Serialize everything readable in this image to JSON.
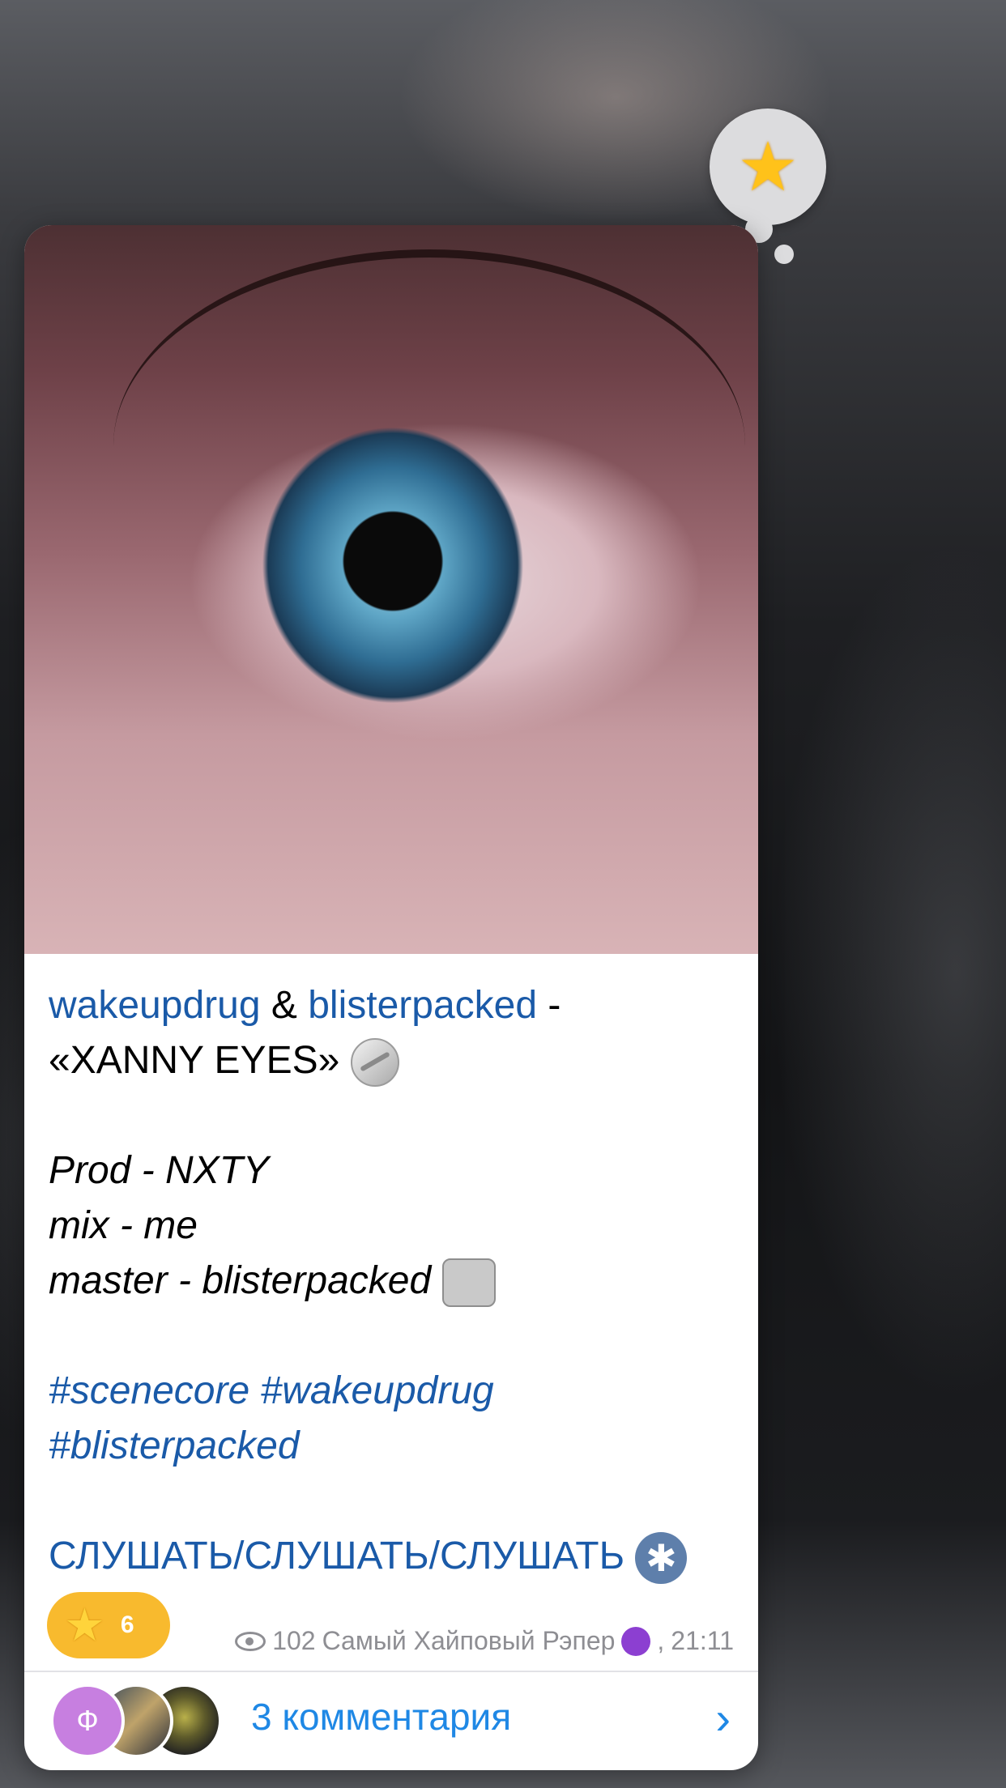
{
  "post": {
    "caption": {
      "artist1": "wakeupdrug",
      "amp": " & ",
      "artist2": "blisterpacked",
      "dash": " -",
      "title": "«XANNY EYES»",
      "prod": "Prod - NXTY",
      "mix": "mix - me",
      "master": "master - blisterpacked",
      "tag1": "#scenecore #wakeupdrug",
      "tag2": "#blisterpacked",
      "listen": "СЛУШАТЬ/СЛУШАТЬ/СЛУШАТЬ"
    },
    "meta": {
      "views": "102",
      "author": "Самый Хайповый Рэпер",
      "time_sep": ",",
      "time": "21:11"
    },
    "reaction": {
      "icon": "star-icon",
      "count": "6",
      "color": "#f8ba2e"
    },
    "comments": {
      "avatar_initial": "Ф",
      "label": "3 комментария",
      "accent": "#1f88e5"
    }
  }
}
